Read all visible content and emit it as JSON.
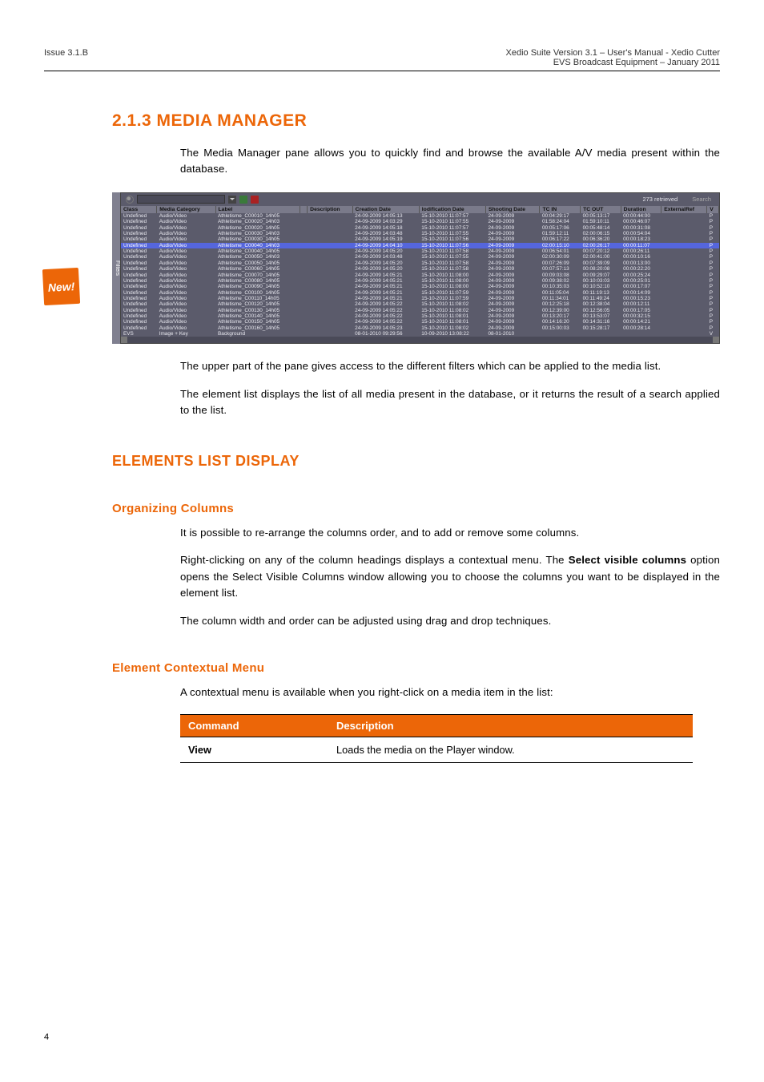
{
  "header": {
    "issue": "Issue 3.1.B",
    "title": "Xedio Suite Version 3.1 – User's Manual - Xedio Cutter",
    "company": "EVS Broadcast Equipment – January 2011"
  },
  "new_badge": "New!",
  "section1_title": "2.1.3 MEDIA MANAGER",
  "section1_p1": "The Media Manager pane allows you to quickly find and browse the available A/V media present within the database.",
  "screenshot": {
    "filters_tab": "Filters",
    "toolbar": {
      "retrieved": "273 retrieved",
      "search": "Search"
    },
    "columns": [
      "Class",
      "Media Category",
      "Label",
      "",
      "Description",
      "Creation Date",
      "lodification Date",
      "Shooting Date",
      "TC IN",
      "TC OUT",
      "Duration",
      "ExternalRef",
      "V"
    ],
    "rows": [
      {
        "class": "Undefined",
        "cat": "Audio/Video",
        "label": "Athletisme_C00010_14h05",
        "desc": "",
        "cdate": "24-09-2009 14:05:13",
        "mdate": "15-10-2010 11:07:57",
        "sdate": "24-09-2009",
        "tcin": "00:04:29:17",
        "tcout": "00:05:13:17",
        "dur": "00:00:44:00",
        "ext": "",
        "v": "P"
      },
      {
        "class": "Undefined",
        "cat": "Audio/Video",
        "label": "Athletisme_C00020_14h03",
        "desc": "",
        "cdate": "24-09-2009 14:03:29",
        "mdate": "15-10-2010 11:07:55",
        "sdate": "24-09-2009",
        "tcin": "01:58:24:04",
        "tcout": "01:59:10:11",
        "dur": "00:00:46:07",
        "ext": "",
        "v": "P"
      },
      {
        "class": "Undefined",
        "cat": "Audio/Video",
        "label": "Athletisme_C00020_14h05",
        "desc": "",
        "cdate": "24-09-2009 14:05:18",
        "mdate": "15-10-2010 11:07:57",
        "sdate": "24-09-2009",
        "tcin": "00:05:17:06",
        "tcout": "00:05:48:14",
        "dur": "00:00:31:08",
        "ext": "",
        "v": "P"
      },
      {
        "class": "Undefined",
        "cat": "Audio/Video",
        "label": "Athletisme_C00030_14h03",
        "desc": "",
        "cdate": "24-09-2009 14:03:48",
        "mdate": "15-10-2010 11:07:55",
        "sdate": "24-09-2009",
        "tcin": "01:59:12:11",
        "tcout": "02:00:06:15",
        "dur": "00:00:54:04",
        "ext": "",
        "v": "P"
      },
      {
        "class": "Undefined",
        "cat": "Audio/Video",
        "label": "Athletisme_C00030_14h05",
        "desc": "",
        "cdate": "24-09-2009 14:05:19",
        "mdate": "15-10-2010 11:07:56",
        "sdate": "24-09-2009",
        "tcin": "00:06:17:22",
        "tcout": "00:06:36:20",
        "dur": "00:00:18:23",
        "ext": "",
        "v": "P"
      },
      {
        "class": "Undefined",
        "cat": "Audio/Video",
        "label": "Athletisme_C00040_14h03",
        "desc": "",
        "cdate": "24-09-2009 14:04:10",
        "mdate": "15-10-2010 11:07:56",
        "sdate": "24-09-2009",
        "tcin": "02:00:15:10",
        "tcout": "02:00:26:17",
        "dur": "00:00:11:07",
        "ext": "",
        "v": "P",
        "highlight": true
      },
      {
        "class": "Undefined",
        "cat": "Audio/Video",
        "label": "Athletisme_C00040_14h05",
        "desc": "",
        "cdate": "24-09-2009 14:05:20",
        "mdate": "15-10-2010 11:07:58",
        "sdate": "24-09-2009",
        "tcin": "00:06:54:01",
        "tcout": "00:07:20:12",
        "dur": "00:00:26:11",
        "ext": "",
        "v": "P"
      },
      {
        "class": "Undefined",
        "cat": "Audio/Video",
        "label": "Athletisme_C00050_14h03",
        "desc": "",
        "cdate": "24-09-2009 14:03:48",
        "mdate": "15-10-2010 11:07:55",
        "sdate": "24-09-2009",
        "tcin": "02:00:30:09",
        "tcout": "02:00:41:00",
        "dur": "00:00:10:16",
        "ext": "",
        "v": "P"
      },
      {
        "class": "Undefined",
        "cat": "Audio/Video",
        "label": "Athletisme_C00050_14h05",
        "desc": "",
        "cdate": "24-09-2009 14:05:20",
        "mdate": "15-10-2010 11:07:58",
        "sdate": "24-09-2009",
        "tcin": "00:07:26:09",
        "tcout": "00:07:39:09",
        "dur": "00:00:13:00",
        "ext": "",
        "v": "P"
      },
      {
        "class": "Undefined",
        "cat": "Audio/Video",
        "label": "Athletisme_C00060_14h05",
        "desc": "",
        "cdate": "24-09-2009 14:05:20",
        "mdate": "15-10-2010 11:07:58",
        "sdate": "24-09-2009",
        "tcin": "00:07:57:13",
        "tcout": "00:08:20:08",
        "dur": "00:00:22:20",
        "ext": "",
        "v": "P"
      },
      {
        "class": "Undefined",
        "cat": "Audio/Video",
        "label": "Athletisme_C00070_14h05",
        "desc": "",
        "cdate": "24-09-2009 14:05:21",
        "mdate": "15-10-2010 11:08:00",
        "sdate": "24-09-2009",
        "tcin": "00:09:03:08",
        "tcout": "00:09:29:07",
        "dur": "00:00:25:24",
        "ext": "",
        "v": "P"
      },
      {
        "class": "Undefined",
        "cat": "Audio/Video",
        "label": "Athletisme_C00080_14h05",
        "desc": "",
        "cdate": "24-09-2009 14:05:21",
        "mdate": "15-10-2010 11:08:00",
        "sdate": "24-09-2009",
        "tcin": "00:09:38:02",
        "tcout": "00:10:03:03",
        "dur": "00:00:25:01",
        "ext": "",
        "v": "P"
      },
      {
        "class": "Undefined",
        "cat": "Audio/Video",
        "label": "Athletisme_C00090_14h05",
        "desc": "",
        "cdate": "24-09-2009 14:05:21",
        "mdate": "15-10-2010 11:08:00",
        "sdate": "24-09-2009",
        "tcin": "00:10:35:03",
        "tcout": "00:10:52:10",
        "dur": "00:00:17:07",
        "ext": "",
        "v": "P"
      },
      {
        "class": "Undefined",
        "cat": "Audio/Video",
        "label": "Athletisme_C00100_14h05",
        "desc": "",
        "cdate": "24-09-2009 14:05:21",
        "mdate": "15-10-2010 11:07:59",
        "sdate": "24-09-2009",
        "tcin": "00:11:05:04",
        "tcout": "00:11:19:13",
        "dur": "00:00:14:09",
        "ext": "",
        "v": "P"
      },
      {
        "class": "Undefined",
        "cat": "Audio/Video",
        "label": "Athletisme_C00110_14h05",
        "desc": "",
        "cdate": "24-09-2009 14:05:21",
        "mdate": "15-10-2010 11:07:59",
        "sdate": "24-09-2009",
        "tcin": "00:11:34:01",
        "tcout": "00:11:49:24",
        "dur": "00:00:15:23",
        "ext": "",
        "v": "P"
      },
      {
        "class": "Undefined",
        "cat": "Audio/Video",
        "label": "Athletisme_C00120_14h05",
        "desc": "",
        "cdate": "24-09-2009 14:05:22",
        "mdate": "15-10-2010 11:08:02",
        "sdate": "24-09-2009",
        "tcin": "00:12:25:18",
        "tcout": "00:12:38:04",
        "dur": "00:00:12:11",
        "ext": "",
        "v": "P"
      },
      {
        "class": "Undefined",
        "cat": "Audio/Video",
        "label": "Athletisme_C00130_14h05",
        "desc": "",
        "cdate": "24-09-2009 14:05:22",
        "mdate": "15-10-2010 11:08:02",
        "sdate": "24-09-2009",
        "tcin": "00:12:39:00",
        "tcout": "00:12:56:05",
        "dur": "00:00:17:05",
        "ext": "",
        "v": "P"
      },
      {
        "class": "Undefined",
        "cat": "Audio/Video",
        "label": "Athletisme_C00140_14h05",
        "desc": "",
        "cdate": "24-09-2009 14:05:22",
        "mdate": "15-10-2010 11:08:01",
        "sdate": "24-09-2009",
        "tcin": "00:13:20:17",
        "tcout": "00:13:53:07",
        "dur": "00:00:32:15",
        "ext": "",
        "v": "P"
      },
      {
        "class": "Undefined",
        "cat": "Audio/Video",
        "label": "Athletisme_C00150_14h05",
        "desc": "",
        "cdate": "24-09-2009 14:05:22",
        "mdate": "15-10-2010 11:08:01",
        "sdate": "24-09-2009",
        "tcin": "00:14:16:20",
        "tcout": "00:14:31:16",
        "dur": "00:00:14:21",
        "ext": "",
        "v": "P"
      },
      {
        "class": "Undefined",
        "cat": "Audio/Video",
        "label": "Athletisme_C00160_14h05",
        "desc": "",
        "cdate": "24-09-2009 14:05:23",
        "mdate": "15-10-2010 11:08:02",
        "sdate": "24-09-2009",
        "tcin": "00:15:00:03",
        "tcout": "00:15:28:17",
        "dur": "00:00:28:14",
        "ext": "",
        "v": "P"
      },
      {
        "class": "EVS",
        "cat": "Image + Key",
        "label": "Background",
        "desc": "",
        "cdate": "08-01-2010 09:29:56",
        "mdate": "10-09-2010 13:08:22",
        "sdate": "08-01-2010",
        "tcin": "",
        "tcout": "",
        "dur": "",
        "ext": "",
        "v": "V"
      }
    ]
  },
  "section1_p2": "The upper part of the pane gives access to the different filters which can be applied to the media list.",
  "section1_p3": "The element list displays the list of all media present in the database, or it returns the result of a search applied to the list.",
  "subsec1_title": "ELEMENTS LIST DISPLAY",
  "subsub1_title": "Organizing Columns",
  "subsec1_p1": "It is possible to re-arrange the columns order, and to add or remove some columns.",
  "subsec1_p2a": "Right-clicking on any of the column headings displays a contextual menu. The ",
  "subsec1_p2b_bold": "Select visible columns",
  "subsec1_p2c": " option opens the Select Visible Columns window allowing you to choose the columns you want to be displayed in the element list.",
  "subsec1_p3": "The column width and order can be adjusted using drag and drop techniques.",
  "subsub2_title": "Element Contextual Menu",
  "subsec2_p1": "A contextual menu is available when you right-click on a media item in the list:",
  "cmd_table": {
    "h1": "Command",
    "h2": "Description",
    "r1c1": "View",
    "r1c2": "Loads the media on the Player window."
  },
  "page_number": "4"
}
